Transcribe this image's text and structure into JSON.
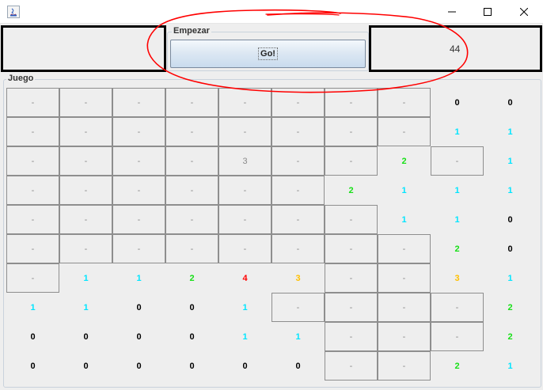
{
  "window": {
    "minimize_glyph": "—",
    "maximize_glyph": "☐",
    "close_glyph": "✕"
  },
  "counter": {
    "value": "44"
  },
  "start_group": {
    "legend": "Empezar",
    "go_label": "Go!"
  },
  "game_group": {
    "legend": "Juego"
  },
  "colors": {
    "accent_annotation": "#ff0000",
    "num_1": "#00e5ff",
    "num_2": "#18e018",
    "num_3": "#ffc000",
    "num_4": "#ff0000",
    "num_0": "#000000"
  },
  "board": {
    "rows": [
      [
        {
          "t": "-",
          "c": "g"
        },
        {
          "t": "-",
          "c": "g"
        },
        {
          "t": "-",
          "c": "g"
        },
        {
          "t": "-",
          "c": "g"
        },
        {
          "t": "-",
          "c": "g"
        },
        {
          "t": "-",
          "c": "g"
        },
        {
          "t": "-",
          "c": "g"
        },
        {
          "t": "-",
          "c": "g"
        },
        {
          "t": "0",
          "c": "0"
        },
        {
          "t": "0",
          "c": "0"
        }
      ],
      [
        {
          "t": "-",
          "c": "g"
        },
        {
          "t": "-",
          "c": "g"
        },
        {
          "t": "-",
          "c": "g"
        },
        {
          "t": "-",
          "c": "g"
        },
        {
          "t": "-",
          "c": "g"
        },
        {
          "t": "-",
          "c": "g"
        },
        {
          "t": "-",
          "c": "g"
        },
        {
          "t": "-",
          "c": "g"
        },
        {
          "t": "1",
          "c": "1"
        },
        {
          "t": "1",
          "c": "1"
        }
      ],
      [
        {
          "t": "-",
          "c": "g"
        },
        {
          "t": "-",
          "c": "g"
        },
        {
          "t": "-",
          "c": "g"
        },
        {
          "t": "-",
          "c": "g"
        },
        {
          "t": "3",
          "c": "3b"
        },
        {
          "t": "-",
          "c": "g"
        },
        {
          "t": "-",
          "c": "g"
        },
        {
          "t": "2",
          "c": "2"
        },
        {
          "t": "-",
          "c": "g"
        },
        {
          "t": "1",
          "c": "1"
        }
      ],
      [
        {
          "t": "-",
          "c": "g"
        },
        {
          "t": "-",
          "c": "g"
        },
        {
          "t": "-",
          "c": "g"
        },
        {
          "t": "-",
          "c": "g"
        },
        {
          "t": "-",
          "c": "g"
        },
        {
          "t": "-",
          "c": "g"
        },
        {
          "t": "2",
          "c": "2"
        },
        {
          "t": "1",
          "c": "1"
        },
        {
          "t": "1",
          "c": "1"
        },
        {
          "t": "1",
          "c": "1"
        }
      ],
      [
        {
          "t": "-",
          "c": "g"
        },
        {
          "t": "-",
          "c": "g"
        },
        {
          "t": "-",
          "c": "g"
        },
        {
          "t": "-",
          "c": "g"
        },
        {
          "t": "-",
          "c": "g"
        },
        {
          "t": "-",
          "c": "g"
        },
        {
          "t": "-",
          "c": "g"
        },
        {
          "t": "1",
          "c": "1"
        },
        {
          "t": "1",
          "c": "1"
        },
        {
          "t": "0",
          "c": "0"
        }
      ],
      [
        {
          "t": "-",
          "c": "g"
        },
        {
          "t": "-",
          "c": "g"
        },
        {
          "t": "-",
          "c": "g"
        },
        {
          "t": "-",
          "c": "g"
        },
        {
          "t": "-",
          "c": "g"
        },
        {
          "t": "-",
          "c": "g"
        },
        {
          "t": "-",
          "c": "g"
        },
        {
          "t": "-",
          "c": "g"
        },
        {
          "t": "2",
          "c": "2"
        },
        {
          "t": "0",
          "c": "0"
        }
      ],
      [
        {
          "t": "-",
          "c": "g"
        },
        {
          "t": "1",
          "c": "1"
        },
        {
          "t": "1",
          "c": "1"
        },
        {
          "t": "2",
          "c": "2"
        },
        {
          "t": "4",
          "c": "4"
        },
        {
          "t": "3",
          "c": "3"
        },
        {
          "t": "-",
          "c": "g"
        },
        {
          "t": "-",
          "c": "g"
        },
        {
          "t": "3",
          "c": "3"
        },
        {
          "t": "1",
          "c": "1"
        }
      ],
      [
        {
          "t": "1",
          "c": "1"
        },
        {
          "t": "1",
          "c": "1"
        },
        {
          "t": "0",
          "c": "0"
        },
        {
          "t": "0",
          "c": "0"
        },
        {
          "t": "1",
          "c": "1"
        },
        {
          "t": "-",
          "c": "g"
        },
        {
          "t": "-",
          "c": "g"
        },
        {
          "t": "-",
          "c": "g"
        },
        {
          "t": "-",
          "c": "g"
        },
        {
          "t": "2",
          "c": "2"
        }
      ],
      [
        {
          "t": "0",
          "c": "0"
        },
        {
          "t": "0",
          "c": "0"
        },
        {
          "t": "0",
          "c": "0"
        },
        {
          "t": "0",
          "c": "0"
        },
        {
          "t": "1",
          "c": "1"
        },
        {
          "t": "1",
          "c": "1"
        },
        {
          "t": "-",
          "c": "g"
        },
        {
          "t": "-",
          "c": "g"
        },
        {
          "t": "-",
          "c": "g"
        },
        {
          "t": "2",
          "c": "2"
        }
      ],
      [
        {
          "t": "0",
          "c": "0"
        },
        {
          "t": "0",
          "c": "0"
        },
        {
          "t": "0",
          "c": "0"
        },
        {
          "t": "0",
          "c": "0"
        },
        {
          "t": "0",
          "c": "0"
        },
        {
          "t": "0",
          "c": "0"
        },
        {
          "t": "-",
          "c": "g"
        },
        {
          "t": "-",
          "c": "g"
        },
        {
          "t": "2",
          "c": "2"
        },
        {
          "t": "1",
          "c": "1"
        }
      ]
    ],
    "unrevealed_cells": [
      [
        1,
        1,
        1,
        1,
        1,
        1,
        1,
        1,
        0,
        0
      ],
      [
        1,
        1,
        1,
        1,
        1,
        1,
        1,
        1,
        0,
        0
      ],
      [
        1,
        1,
        1,
        1,
        1,
        1,
        1,
        0,
        1,
        0
      ],
      [
        1,
        1,
        1,
        1,
        1,
        1,
        0,
        0,
        0,
        0
      ],
      [
        1,
        1,
        1,
        1,
        1,
        1,
        1,
        0,
        0,
        0
      ],
      [
        1,
        1,
        1,
        1,
        1,
        1,
        1,
        1,
        0,
        0
      ],
      [
        1,
        0,
        0,
        0,
        0,
        0,
        1,
        1,
        0,
        0
      ],
      [
        0,
        0,
        0,
        0,
        0,
        1,
        1,
        1,
        1,
        0
      ],
      [
        0,
        0,
        0,
        0,
        0,
        0,
        1,
        1,
        1,
        0
      ],
      [
        0,
        0,
        0,
        0,
        0,
        0,
        1,
        1,
        0,
        0
      ]
    ]
  }
}
